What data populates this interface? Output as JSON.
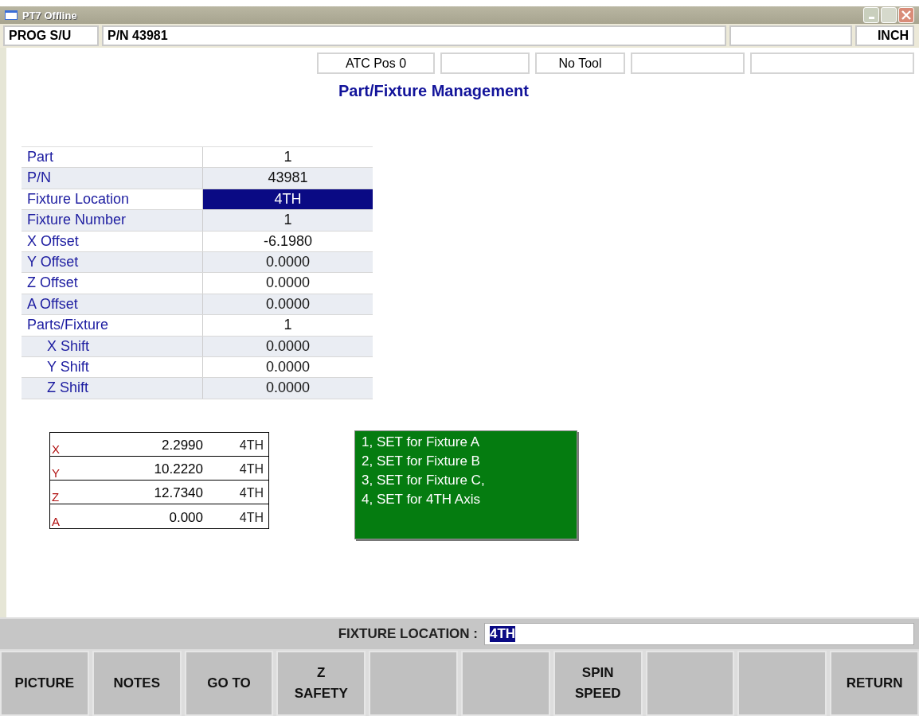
{
  "window": {
    "title": "PT7 Offline"
  },
  "header": {
    "mode": "PROG S/U",
    "part_number": "P/N 43981",
    "units": "INCH"
  },
  "status": {
    "atc": "ATC Pos 0",
    "tool": "No Tool"
  },
  "heading": "Part/Fixture Management",
  "parameters": [
    {
      "label": "Part",
      "value": "1",
      "selected": false
    },
    {
      "label": "P/N",
      "value": "43981",
      "selected": false
    },
    {
      "label": "Fixture Location",
      "value": "4TH",
      "selected": true
    },
    {
      "label": "Fixture Number",
      "value": "1",
      "selected": false
    },
    {
      "label": "X Offset",
      "value": "-6.1980",
      "selected": false
    },
    {
      "label": "Y Offset",
      "value": "0.0000",
      "selected": false
    },
    {
      "label": "Z Offset",
      "value": "0.0000",
      "selected": false
    },
    {
      "label": "A Offset",
      "value": "0.0000",
      "selected": false
    },
    {
      "label": "Parts/Fixture",
      "value": "1",
      "selected": false,
      "children": [
        {
          "label": "X Shift",
          "value": "0.0000",
          "selected": false
        },
        {
          "label": "Y Shift",
          "value": "0.0000",
          "selected": false
        },
        {
          "label": "Z Shift",
          "value": "0.0000",
          "selected": false
        }
      ]
    }
  ],
  "positions": [
    {
      "axis": "X",
      "value": "2.2990",
      "location": "4TH"
    },
    {
      "axis": "Y",
      "value": "10.2220",
      "location": "4TH"
    },
    {
      "axis": "Z",
      "value": "12.7340",
      "location": "4TH"
    },
    {
      "axis": "A",
      "value": "0.000",
      "location": "4TH"
    }
  ],
  "help_lines": [
    "1, SET for Fixture A",
    "2, SET for Fixture B",
    "3, SET for Fixture C,",
    "4, SET for 4TH Axis"
  ],
  "prompt": {
    "label": "FIXTURE LOCATION :",
    "value": "4TH"
  },
  "soft_keys": [
    {
      "kind": "label",
      "lines": [
        "PICTURE"
      ]
    },
    {
      "kind": "label",
      "lines": [
        "NOTES"
      ]
    },
    {
      "kind": "label",
      "lines": [
        "GO TO"
      ]
    },
    {
      "kind": "label",
      "lines": [
        "Z",
        "SAFETY"
      ]
    },
    {
      "kind": "blank"
    },
    {
      "kind": "blank"
    },
    {
      "kind": "label",
      "lines": [
        "SPIN",
        "SPEED"
      ]
    },
    {
      "kind": "blank"
    },
    {
      "kind": "blank"
    },
    {
      "kind": "label",
      "lines": [
        "RETURN"
      ]
    }
  ]
}
